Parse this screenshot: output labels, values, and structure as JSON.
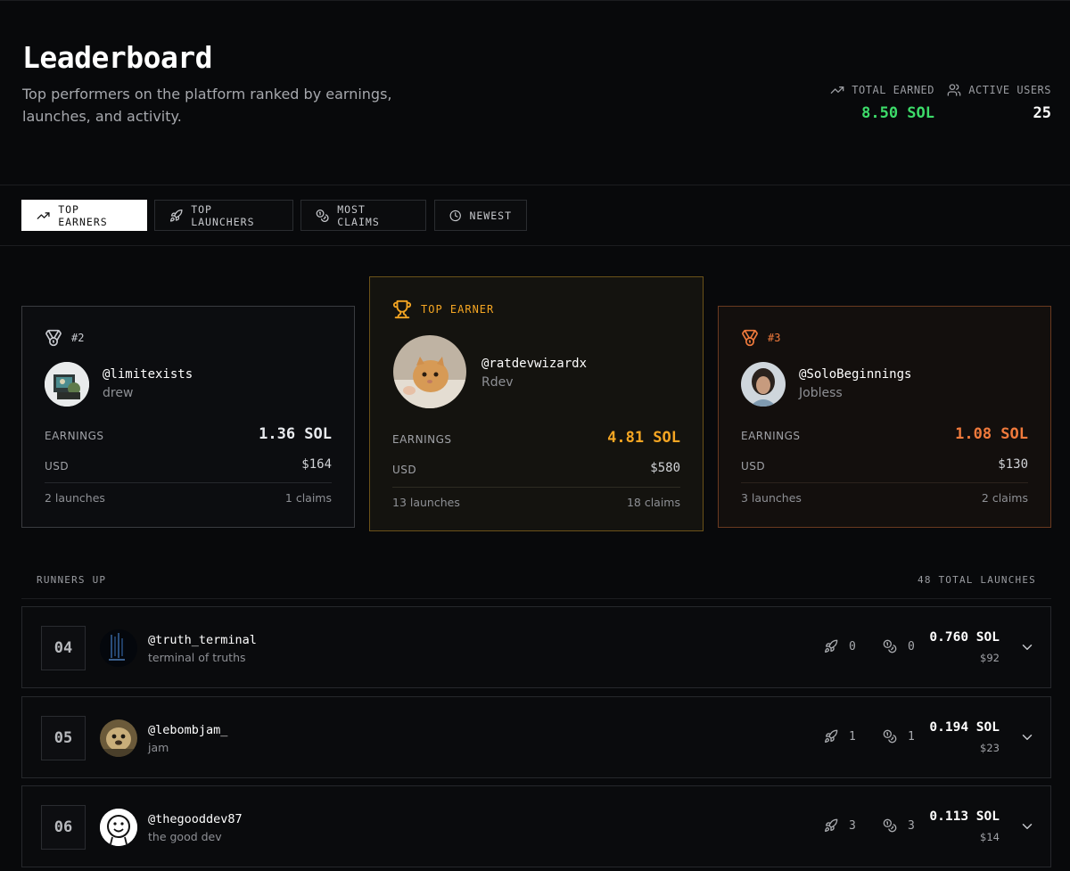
{
  "header": {
    "title": "Leaderboard",
    "subtitle": "Top performers on the platform ranked by earnings, launches, and activity.",
    "total_earned_label": "TOTAL EARNED",
    "total_earned_value": "8.50 SOL",
    "active_users_label": "ACTIVE USERS",
    "active_users_value": "25"
  },
  "tabs": [
    {
      "label": "TOP EARNERS",
      "icon": "trending-up-icon",
      "active": true
    },
    {
      "label": "TOP LAUNCHERS",
      "icon": "rocket-icon",
      "active": false
    },
    {
      "label": "MOST CLAIMS",
      "icon": "coins-icon",
      "active": false
    },
    {
      "label": "NEWEST",
      "icon": "clock-icon",
      "active": false
    }
  ],
  "podium": {
    "first": {
      "badge": "TOP EARNER",
      "handle": "@ratdevwizardx",
      "name": "Rdev",
      "earnings_label": "EARNINGS",
      "earnings": "4.81 SOL",
      "usd_label": "USD",
      "usd": "$580",
      "launches": "13 launches",
      "claims": "18 claims"
    },
    "second": {
      "badge": "#2",
      "handle": "@limitexists",
      "name": "drew",
      "earnings_label": "EARNINGS",
      "earnings": "1.36 SOL",
      "usd_label": "USD",
      "usd": "$164",
      "launches": "2 launches",
      "claims": "1 claims"
    },
    "third": {
      "badge": "#3",
      "handle": "@SoloBeginnings",
      "name": "Jobless",
      "earnings_label": "EARNINGS",
      "earnings": "1.08 SOL",
      "usd_label": "USD",
      "usd": "$130",
      "launches": "3 launches",
      "claims": "2 claims"
    }
  },
  "runners_up": {
    "title": "RUNNERS UP",
    "total": "48 TOTAL LAUNCHES",
    "rows": [
      {
        "rank": "04",
        "handle": "@truth_terminal",
        "name": "terminal of truths",
        "launches": "0",
        "claims": "0",
        "sol": "0.760 SOL",
        "usd": "$92"
      },
      {
        "rank": "05",
        "handle": "@lebombjam_",
        "name": "jam",
        "launches": "1",
        "claims": "1",
        "sol": "0.194 SOL",
        "usd": "$23"
      },
      {
        "rank": "06",
        "handle": "@thegooddev87",
        "name": "the good dev",
        "launches": "3",
        "claims": "3",
        "sol": "0.113 SOL",
        "usd": "$14"
      }
    ]
  },
  "colors": {
    "gold": "#f5a623",
    "bronze": "#f07a3c",
    "green": "#3ddc6a",
    "silver": "#c8cad0"
  }
}
